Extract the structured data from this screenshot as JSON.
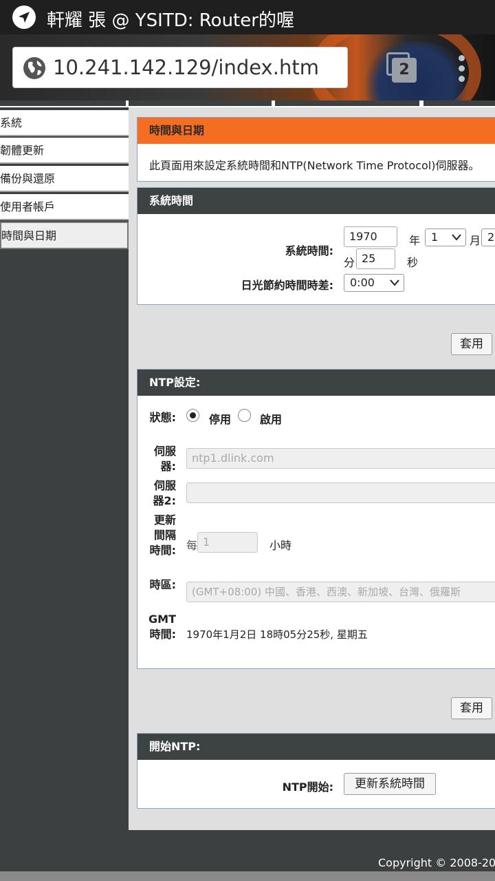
{
  "status_bar": {
    "title": "軒耀 張 @ YSITD: Router的喔",
    "nav_icon": "navigation-arrow-icon"
  },
  "browser": {
    "url": "10.241.142.129/index.htm",
    "tab_count": "2"
  },
  "sidebar": {
    "items": [
      {
        "label": "系統"
      },
      {
        "label": "韌體更新"
      },
      {
        "label": "備份與還原"
      },
      {
        "label": "使用者帳戶"
      },
      {
        "label": "時間與日期",
        "active": true
      }
    ]
  },
  "time_date": {
    "header": "時間與日期",
    "description": "此頁面用來設定系統時間和NTP(Network Time Protocol)伺服器。"
  },
  "system_time": {
    "header": "系統時間",
    "label": "系統時間:",
    "year_value": "1970",
    "year_unit": "年",
    "month_value": "1",
    "month_unit": "月",
    "day_value": "2",
    "minute_unit": "分",
    "second_value": "25",
    "second_unit": "秒",
    "dst_label": "日光節約時間時差:",
    "dst_value": "0:00",
    "apply_label": "套用"
  },
  "ntp_settings": {
    "header": "NTP設定:",
    "status_label": "狀態:",
    "status_disable": "停用",
    "status_enable": "啟用",
    "status_selected": "停用",
    "server_label": "伺服器:",
    "server_placeholder": "ntp1.dlink.com",
    "server2_label": "伺服器2:",
    "server2_value": "",
    "interval_label": "更新間隔時間:",
    "interval_prefix": "每",
    "interval_value": "1",
    "interval_unit": "小時",
    "timezone_label": "時區:",
    "timezone_value": "(GMT+08:00) 中國、香港、西澳、新加坡、台灣、俄羅斯",
    "gmt_label": "GMT時間:",
    "gmt_value": "1970年1月2日 18時05分25秒, 星期五",
    "apply_label": "套用"
  },
  "start_ntp": {
    "header": "開始NTP:",
    "label": "NTP開始:",
    "button_label": "更新系統時間"
  },
  "footer": {
    "copyright": "Copyright © 2008-20"
  },
  "colors": {
    "accent": "#f46d21",
    "header_dark": "#3d4242",
    "sidebar_bg": "#3c4040"
  }
}
